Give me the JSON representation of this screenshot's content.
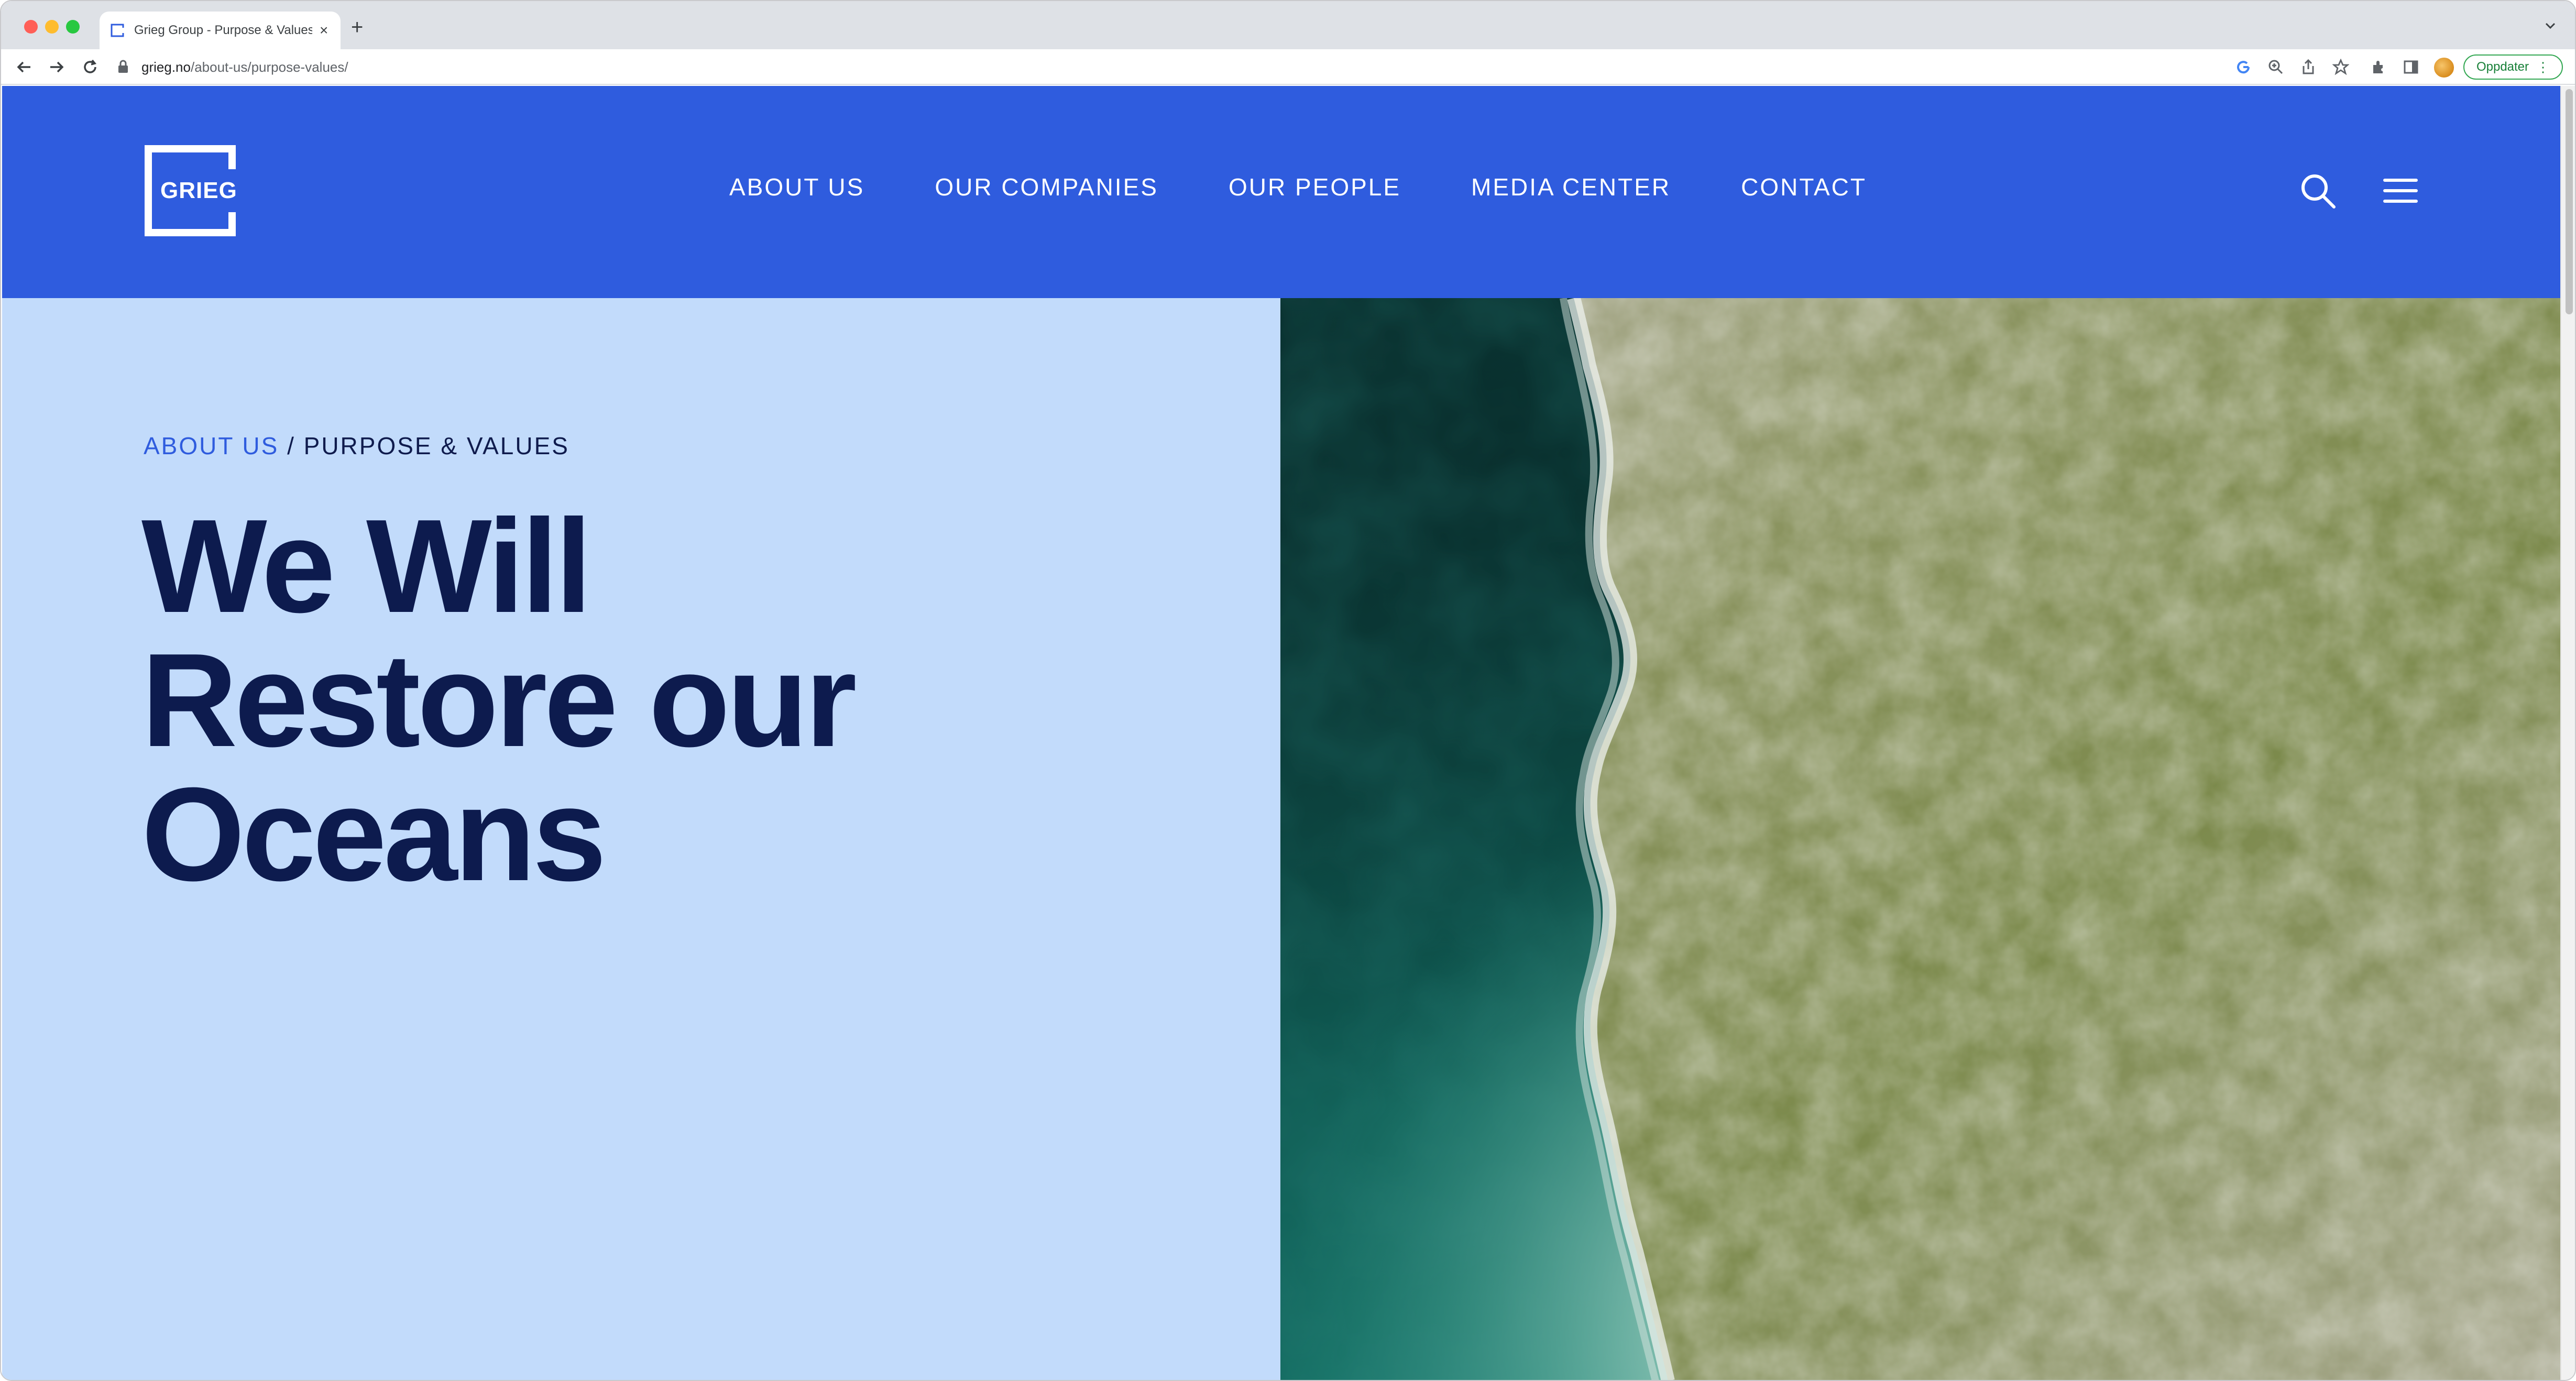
{
  "browser": {
    "tab_title": "Grieg Group - Purpose & Values",
    "tab_close": "×",
    "new_tab": "+",
    "url_host": "grieg.no",
    "url_path": "/about-us/purpose-values/",
    "update_button": "Oppdater",
    "toolbar_icons": [
      "google-icon",
      "zoom-icon",
      "share-icon",
      "bookmark-star-icon",
      "extensions-icon",
      "side-panel-icon",
      "profile-avatar"
    ]
  },
  "header": {
    "logo_text": "GRIEG",
    "nav": [
      {
        "label": "ABOUT US"
      },
      {
        "label": "OUR COMPANIES"
      },
      {
        "label": "OUR PEOPLE"
      },
      {
        "label": "MEDIA CENTER"
      },
      {
        "label": "CONTACT"
      }
    ],
    "icons": [
      "search-icon",
      "hamburger-menu-icon"
    ],
    "background_color": "#2f5cde"
  },
  "hero": {
    "breadcrumb": {
      "parent": "ABOUT US",
      "separator": " / ",
      "current": "PURPOSE & VALUES"
    },
    "title_lines": [
      "We Will",
      "Restore our",
      "Oceans"
    ],
    "background_color": "#c2dbfb",
    "title_color": "#0d1b4e",
    "image_subject": "aerial-coastline-photo"
  }
}
